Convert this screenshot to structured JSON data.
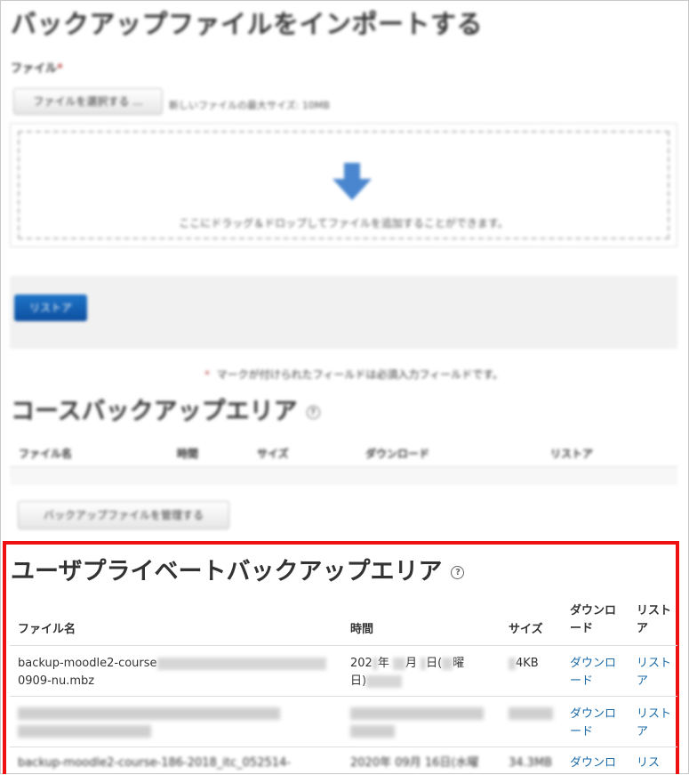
{
  "import": {
    "title": "バックアップファイルをインポートする",
    "file_label": "ファイル",
    "required_mark": "*",
    "choose_button": "ファイルを選択する ...",
    "max_size": "新しいファイルの最大サイズ: 10MB",
    "drop_text": "ここにドラッグ＆ドロップしてファイルを追加することができます。",
    "restore_button": "リストア",
    "required_note": "マークが付けられたフィールドは必須入力フィールドです。"
  },
  "course_area": {
    "title": "コースバックアップエリア",
    "help_icon": "?",
    "headers": {
      "filename": "ファイル名",
      "time": "時間",
      "size": "サイズ",
      "download": "ダウンロード",
      "restore": "リストア"
    },
    "manage_button": "バックアップファイルを管理する"
  },
  "user_area": {
    "title": "ユーザプライベートバックアップエリア",
    "help_icon": "?",
    "headers": {
      "filename": "ファイル名",
      "time": "時間",
      "size": "サイズ",
      "download_1": "ダウンロ",
      "download_2": "ード",
      "restore_1": "リスト",
      "restore_2": "ア"
    },
    "rows": [
      {
        "file_1": "backup-moodle2-course",
        "file_2": "0909-nu.mbz",
        "time_1a": "202",
        "time_1b": "年",
        "time_1c": "月",
        "time_1d": "日(",
        "time_1e": "曜",
        "time_2": "日)",
        "size": "4KB",
        "download_1": "ダウンロ",
        "download_2": "ード",
        "restore_1": "リスト",
        "restore_2": "ア"
      },
      {
        "download_1": "ダウンロ",
        "download_2": "ード",
        "restore_1": "リスト",
        "restore_2": "ア"
      },
      {
        "file_1": "backup-moodle2-course-186-2018_itc_052514-",
        "time_1": "2020年 09月 16日(水曜",
        "size": "34.3MB",
        "download_1": "ダウンロ",
        "restore_1": "リス"
      }
    ]
  },
  "colors": {
    "highlight": "#ee1111",
    "link": "#1a6aa8",
    "restore_button": "#0d4fa0",
    "required": "#b94a48"
  }
}
